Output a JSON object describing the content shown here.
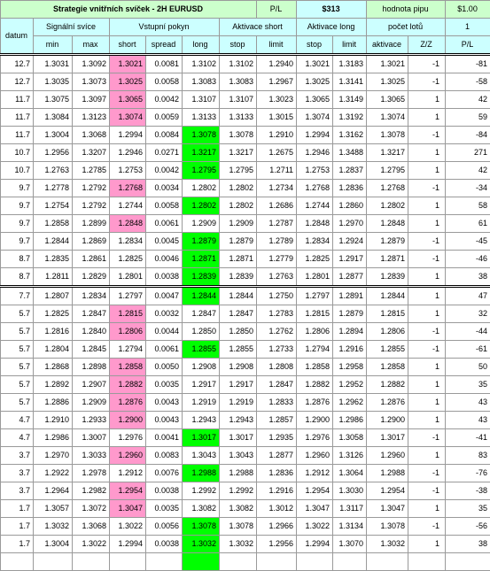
{
  "header": {
    "title": "Strategie vnitřních svíček - 2H EURUSD",
    "pl_label": "P/L",
    "pl_value": "$313",
    "pip_label": "hodnota pipu",
    "pip_value": "$1.00",
    "datum": "datum",
    "signal_group": "Signální svíce",
    "entry_group": "Vstupní pokyn",
    "act_short_group": "Aktivace short",
    "act_long_group": "Aktivace long",
    "lots_label": "počet lotů",
    "lots_value": "1"
  },
  "columns": [
    "min",
    "max",
    "short",
    "spread",
    "long",
    "stop",
    "limit",
    "stop",
    "limit",
    "aktivace",
    "Z/Z",
    "P/L"
  ],
  "colors": {
    "header": "#ccffff",
    "title": "#ccffcc",
    "short_active": "#ff99cc",
    "long_active": "#00ff00"
  },
  "rows": [
    {
      "date": "12.7",
      "min": "1.3031",
      "max": "1.3092",
      "short": "1.3021",
      "spread": "0.0081",
      "long": "1.3102",
      "s_stop": "1.3102",
      "s_limit": "1.2940",
      "l_stop": "1.3021",
      "l_limit": "1.3183",
      "act": "1.3021",
      "zz": "-1",
      "pl": "-81",
      "hl": "short"
    },
    {
      "date": "12.7",
      "min": "1.3035",
      "max": "1.3073",
      "short": "1.3025",
      "spread": "0.0058",
      "long": "1.3083",
      "s_stop": "1.3083",
      "s_limit": "1.2967",
      "l_stop": "1.3025",
      "l_limit": "1.3141",
      "act": "1.3025",
      "zz": "-1",
      "pl": "-58",
      "hl": "short"
    },
    {
      "date": "11.7",
      "min": "1.3075",
      "max": "1.3097",
      "short": "1.3065",
      "spread": "0.0042",
      "long": "1.3107",
      "s_stop": "1.3107",
      "s_limit": "1.3023",
      "l_stop": "1.3065",
      "l_limit": "1.3149",
      "act": "1.3065",
      "zz": "1",
      "pl": "42",
      "hl": "short"
    },
    {
      "date": "11.7",
      "min": "1.3084",
      "max": "1.3123",
      "short": "1.3074",
      "spread": "0.0059",
      "long": "1.3133",
      "s_stop": "1.3133",
      "s_limit": "1.3015",
      "l_stop": "1.3074",
      "l_limit": "1.3192",
      "act": "1.3074",
      "zz": "1",
      "pl": "59",
      "hl": "short"
    },
    {
      "date": "11.7",
      "min": "1.3004",
      "max": "1.3068",
      "short": "1.2994",
      "spread": "0.0084",
      "long": "1.3078",
      "s_stop": "1.3078",
      "s_limit": "1.2910",
      "l_stop": "1.2994",
      "l_limit": "1.3162",
      "act": "1.3078",
      "zz": "-1",
      "pl": "-84",
      "hl": "long"
    },
    {
      "date": "10.7",
      "min": "1.2956",
      "max": "1.3207",
      "short": "1.2946",
      "spread": "0.0271",
      "long": "1.3217",
      "s_stop": "1.3217",
      "s_limit": "1.2675",
      "l_stop": "1.2946",
      "l_limit": "1.3488",
      "act": "1.3217",
      "zz": "1",
      "pl": "271",
      "hl": "long"
    },
    {
      "date": "10.7",
      "min": "1.2763",
      "max": "1.2785",
      "short": "1.2753",
      "spread": "0.0042",
      "long": "1.2795",
      "s_stop": "1.2795",
      "s_limit": "1.2711",
      "l_stop": "1.2753",
      "l_limit": "1.2837",
      "act": "1.2795",
      "zz": "1",
      "pl": "42",
      "hl": "long"
    },
    {
      "date": "9.7",
      "min": "1.2778",
      "max": "1.2792",
      "short": "1.2768",
      "spread": "0.0034",
      "long": "1.2802",
      "s_stop": "1.2802",
      "s_limit": "1.2734",
      "l_stop": "1.2768",
      "l_limit": "1.2836",
      "act": "1.2768",
      "zz": "-1",
      "pl": "-34",
      "hl": "short"
    },
    {
      "date": "9.7",
      "min": "1.2754",
      "max": "1.2792",
      "short": "1.2744",
      "spread": "0.0058",
      "long": "1.2802",
      "s_stop": "1.2802",
      "s_limit": "1.2686",
      "l_stop": "1.2744",
      "l_limit": "1.2860",
      "act": "1.2802",
      "zz": "1",
      "pl": "58",
      "hl": "long"
    },
    {
      "date": "9.7",
      "min": "1.2858",
      "max": "1.2899",
      "short": "1.2848",
      "spread": "0.0061",
      "long": "1.2909",
      "s_stop": "1.2909",
      "s_limit": "1.2787",
      "l_stop": "1.2848",
      "l_limit": "1.2970",
      "act": "1.2848",
      "zz": "1",
      "pl": "61",
      "hl": "short"
    },
    {
      "date": "9.7",
      "min": "1.2844",
      "max": "1.2869",
      "short": "1.2834",
      "spread": "0.0045",
      "long": "1.2879",
      "s_stop": "1.2879",
      "s_limit": "1.2789",
      "l_stop": "1.2834",
      "l_limit": "1.2924",
      "act": "1.2879",
      "zz": "-1",
      "pl": "-45",
      "hl": "long"
    },
    {
      "date": "8.7",
      "min": "1.2835",
      "max": "1.2861",
      "short": "1.2825",
      "spread": "0.0046",
      "long": "1.2871",
      "s_stop": "1.2871",
      "s_limit": "1.2779",
      "l_stop": "1.2825",
      "l_limit": "1.2917",
      "act": "1.2871",
      "zz": "-1",
      "pl": "-46",
      "hl": "long"
    },
    {
      "date": "8.7",
      "min": "1.2811",
      "max": "1.2829",
      "short": "1.2801",
      "spread": "0.0038",
      "long": "1.2839",
      "s_stop": "1.2839",
      "s_limit": "1.2763",
      "l_stop": "1.2801",
      "l_limit": "1.2877",
      "act": "1.2839",
      "zz": "1",
      "pl": "38",
      "hl": "long"
    },
    {
      "date": "7.7",
      "min": "1.2807",
      "max": "1.2834",
      "short": "1.2797",
      "spread": "0.0047",
      "long": "1.2844",
      "s_stop": "1.2844",
      "s_limit": "1.2750",
      "l_stop": "1.2797",
      "l_limit": "1.2891",
      "act": "1.2844",
      "zz": "1",
      "pl": "47",
      "hl": "long"
    },
    {
      "date": "5.7",
      "min": "1.2825",
      "max": "1.2847",
      "short": "1.2815",
      "spread": "0.0032",
      "long": "1.2847",
      "s_stop": "1.2847",
      "s_limit": "1.2783",
      "l_stop": "1.2815",
      "l_limit": "1.2879",
      "act": "1.2815",
      "zz": "1",
      "pl": "32",
      "hl": "short"
    },
    {
      "date": "5.7",
      "min": "1.2816",
      "max": "1.2840",
      "short": "1.2806",
      "spread": "0.0044",
      "long": "1.2850",
      "s_stop": "1.2850",
      "s_limit": "1.2762",
      "l_stop": "1.2806",
      "l_limit": "1.2894",
      "act": "1.2806",
      "zz": "-1",
      "pl": "-44",
      "hl": "short"
    },
    {
      "date": "5.7",
      "min": "1.2804",
      "max": "1.2845",
      "short": "1.2794",
      "spread": "0.0061",
      "long": "1.2855",
      "s_stop": "1.2855",
      "s_limit": "1.2733",
      "l_stop": "1.2794",
      "l_limit": "1.2916",
      "act": "1.2855",
      "zz": "-1",
      "pl": "-61",
      "hl": "long"
    },
    {
      "date": "5.7",
      "min": "1.2868",
      "max": "1.2898",
      "short": "1.2858",
      "spread": "0.0050",
      "long": "1.2908",
      "s_stop": "1.2908",
      "s_limit": "1.2808",
      "l_stop": "1.2858",
      "l_limit": "1.2958",
      "act": "1.2858",
      "zz": "1",
      "pl": "50",
      "hl": "short"
    },
    {
      "date": "5.7",
      "min": "1.2892",
      "max": "1.2907",
      "short": "1.2882",
      "spread": "0.0035",
      "long": "1.2917",
      "s_stop": "1.2917",
      "s_limit": "1.2847",
      "l_stop": "1.2882",
      "l_limit": "1.2952",
      "act": "1.2882",
      "zz": "1",
      "pl": "35",
      "hl": "short"
    },
    {
      "date": "5.7",
      "min": "1.2886",
      "max": "1.2909",
      "short": "1.2876",
      "spread": "0.0043",
      "long": "1.2919",
      "s_stop": "1.2919",
      "s_limit": "1.2833",
      "l_stop": "1.2876",
      "l_limit": "1.2962",
      "act": "1.2876",
      "zz": "1",
      "pl": "43",
      "hl": "short"
    },
    {
      "date": "4.7",
      "min": "1.2910",
      "max": "1.2933",
      "short": "1.2900",
      "spread": "0.0043",
      "long": "1.2943",
      "s_stop": "1.2943",
      "s_limit": "1.2857",
      "l_stop": "1.2900",
      "l_limit": "1.2986",
      "act": "1.2900",
      "zz": "1",
      "pl": "43",
      "hl": "short"
    },
    {
      "date": "4.7",
      "min": "1.2986",
      "max": "1.3007",
      "short": "1.2976",
      "spread": "0.0041",
      "long": "1.3017",
      "s_stop": "1.3017",
      "s_limit": "1.2935",
      "l_stop": "1.2976",
      "l_limit": "1.3058",
      "act": "1.3017",
      "zz": "-1",
      "pl": "-41",
      "hl": "long"
    },
    {
      "date": "3.7",
      "min": "1.2970",
      "max": "1.3033",
      "short": "1.2960",
      "spread": "0.0083",
      "long": "1.3043",
      "s_stop": "1.3043",
      "s_limit": "1.2877",
      "l_stop": "1.2960",
      "l_limit": "1.3126",
      "act": "1.2960",
      "zz": "1",
      "pl": "83",
      "hl": "short"
    },
    {
      "date": "3.7",
      "min": "1.2922",
      "max": "1.2978",
      "short": "1.2912",
      "spread": "0.0076",
      "long": "1.2988",
      "s_stop": "1.2988",
      "s_limit": "1.2836",
      "l_stop": "1.2912",
      "l_limit": "1.3064",
      "act": "1.2988",
      "zz": "-1",
      "pl": "-76",
      "hl": "long"
    },
    {
      "date": "3.7",
      "min": "1.2964",
      "max": "1.2982",
      "short": "1.2954",
      "spread": "0.0038",
      "long": "1.2992",
      "s_stop": "1.2992",
      "s_limit": "1.2916",
      "l_stop": "1.2954",
      "l_limit": "1.3030",
      "act": "1.2954",
      "zz": "-1",
      "pl": "-38",
      "hl": "short"
    },
    {
      "date": "1.7",
      "min": "1.3057",
      "max": "1.3072",
      "short": "1.3047",
      "spread": "0.0035",
      "long": "1.3082",
      "s_stop": "1.3082",
      "s_limit": "1.3012",
      "l_stop": "1.3047",
      "l_limit": "1.3117",
      "act": "1.3047",
      "zz": "1",
      "pl": "35",
      "hl": "short"
    },
    {
      "date": "1.7",
      "min": "1.3032",
      "max": "1.3068",
      "short": "1.3022",
      "spread": "0.0056",
      "long": "1.3078",
      "s_stop": "1.3078",
      "s_limit": "1.2966",
      "l_stop": "1.3022",
      "l_limit": "1.3134",
      "act": "1.3078",
      "zz": "-1",
      "pl": "-56",
      "hl": "long"
    },
    {
      "date": "1.7",
      "min": "1.3004",
      "max": "1.3022",
      "short": "1.2994",
      "spread": "0.0038",
      "long": "1.3032",
      "s_stop": "1.3032",
      "s_limit": "1.2956",
      "l_stop": "1.2994",
      "l_limit": "1.3070",
      "act": "1.3032",
      "zz": "1",
      "pl": "38",
      "hl": "long"
    },
    {
      "date": "",
      "min": "",
      "max": "",
      "short": "",
      "spread": "",
      "long": "",
      "s_stop": "",
      "s_limit": "",
      "l_stop": "",
      "l_limit": "",
      "act": "",
      "zz": "",
      "pl": "",
      "hl": "long"
    }
  ]
}
